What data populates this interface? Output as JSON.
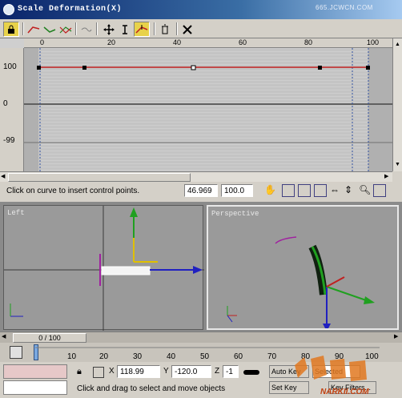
{
  "window": {
    "title": "Scale Deformation(X)",
    "watermark": "665.JCWCN.COM"
  },
  "toolbar": {
    "icons": [
      "lock-icon",
      "make-symmetrical-icon",
      "display-x-icon",
      "display-y-icon",
      "swap-icon",
      "move-icon",
      "scale-point-icon",
      "insert-corner-icon",
      "delete-icon",
      "reset-icon"
    ]
  },
  "ruler": {
    "labels": [
      "0",
      "20",
      "40",
      "60",
      "80",
      "100"
    ]
  },
  "scale": {
    "top": "100",
    "mid": "0",
    "bottom": "-99"
  },
  "status": {
    "message": "Click on curve to insert control points.",
    "frame_value": "46.969",
    "scale_value": "100.0"
  },
  "viewports": {
    "left_label": "Left",
    "persp_label": "Perspective"
  },
  "time": {
    "slider_label": "0 / 100"
  },
  "trackbar": {
    "labels": [
      "10",
      "20",
      "30",
      "40",
      "50",
      "60",
      "70",
      "80",
      "90",
      "100"
    ]
  },
  "bottom": {
    "x_label": "X",
    "x_value": "118.99",
    "y_label": "Y",
    "y_value": "-120.0",
    "z_label": "Z",
    "z_value": "-1",
    "prompt": "Click and drag to select and move objects",
    "auto_key": "Auto Key",
    "selected": "Selected",
    "set_key": "Set Key",
    "key_filters": "Key Filters...",
    "watermark": "NARKII.COM"
  },
  "colors": {
    "curve": "#c02020",
    "title_start": "#0a246a",
    "title_end": "#a6caf0",
    "active_btn": "#e8d24a"
  }
}
